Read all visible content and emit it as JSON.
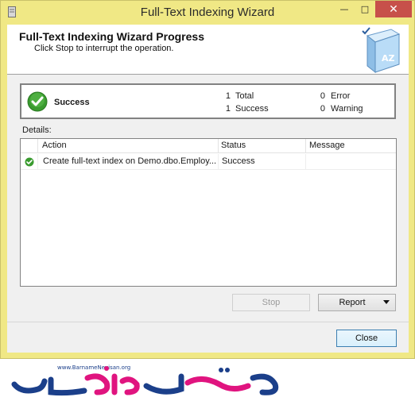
{
  "window": {
    "title": "Full-Text Indexing Wizard",
    "min_glyph": "—",
    "max_glyph": "□",
    "close_glyph": "✕"
  },
  "header": {
    "title": "Full-Text Indexing Wizard Progress",
    "subtitle": "Click Stop to interrupt the operation."
  },
  "summary": {
    "status": "Success",
    "total_count": "1",
    "total_label": "Total",
    "success_count": "1",
    "success_label": "Success",
    "error_count": "0",
    "error_label": "Error",
    "warning_count": "0",
    "warning_label": "Warning"
  },
  "details": {
    "label": "Details:",
    "columns": [
      "Action",
      "Status",
      "Message"
    ],
    "rows": [
      {
        "action": "Create full-text index on Demo.dbo.Employ...",
        "status": "Success",
        "message": ""
      }
    ]
  },
  "buttons": {
    "stop": "Stop",
    "report": "Report",
    "close": "Close"
  },
  "watermark": {
    "url": "www.BarnameNevisan.org"
  },
  "colors": {
    "window_frame": "#f0e885",
    "close_button": "#c7504a",
    "success_green": "#3a9b2f"
  }
}
